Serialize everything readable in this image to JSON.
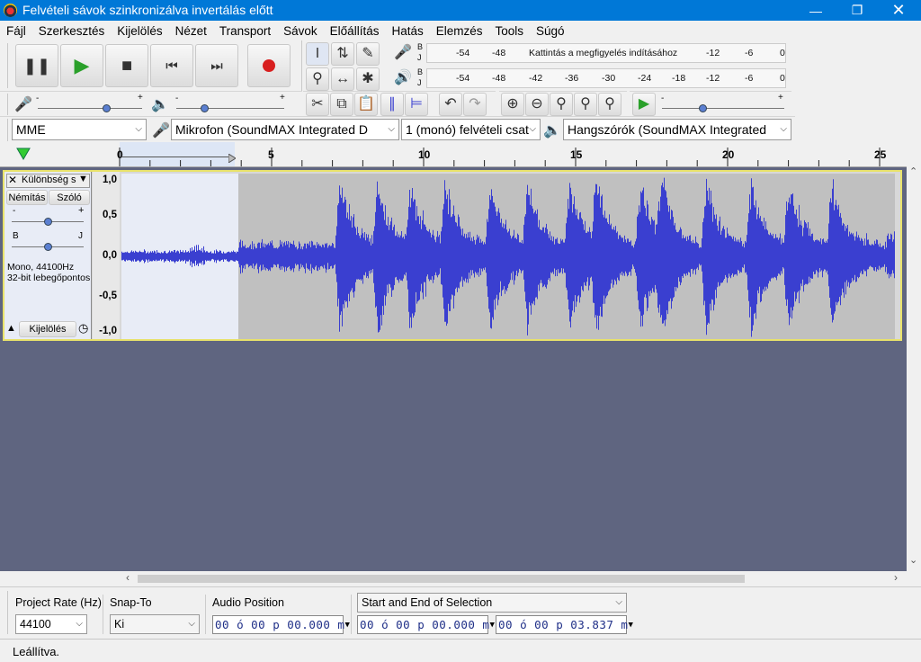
{
  "window": {
    "title": "Felvételi sávok szinkronizálva invertálás előtt"
  },
  "menu": [
    "Fájl",
    "Szerkesztés",
    "Kijelölés",
    "Nézet",
    "Transport",
    "Sávok",
    "Előállítás",
    "Hatás",
    "Elemzés",
    "Tools",
    "Súgó"
  ],
  "meter": {
    "rec_scale_left": [
      "-54",
      "-48"
    ],
    "rec_hint": "Kattintás a megfigyelés indításához",
    "rec_scale_right": [
      "-12",
      "-6",
      "0"
    ],
    "play_scale": [
      "-54",
      "-48",
      "-42",
      "-36",
      "-30",
      "-24",
      "-18",
      "-12",
      "-6",
      "0"
    ],
    "channel_left": "B",
    "channel_right": "J"
  },
  "devices": {
    "host": "MME",
    "mic": "Mikrofon (SoundMAX Integrated D",
    "channels": "1 (monó) felvételi csat",
    "speaker": "Hangszórók (SoundMAX Integrated"
  },
  "ruler": {
    "labels": [
      "0",
      "5",
      "10",
      "15",
      "20",
      "25"
    ]
  },
  "track": {
    "name": "Különbség s",
    "mute": "Némítás",
    "solo": "Szóló",
    "pan_left": "B",
    "pan_right": "J",
    "gain_minus": "-",
    "gain_plus": "+",
    "format_line1": "Mono, 44100Hz",
    "format_line2": "32-bit lebegőpontos",
    "select_label": "Kijelölés",
    "y_labels": [
      "1,0",
      "0,5",
      "0,0",
      "-0,5",
      "-1,0"
    ]
  },
  "selection_bar": {
    "project_rate_label": "Project Rate (Hz)",
    "project_rate_value": "44100",
    "snap_label": "Snap-To",
    "snap_value": "Ki",
    "audio_position_label": "Audio Position",
    "audio_position_value": "00 ó 00 p 00.000 m",
    "selection_mode": "Start and End of Selection",
    "selection_start": "00 ó 00 p 00.000 m",
    "selection_end": "00 ó 00 p 03.837 m"
  },
  "status": {
    "text": "Leállítva."
  },
  "colors": {
    "titlebar": "#0078d7",
    "waveform": "#3a3fd0",
    "selection": "#e8ecf6",
    "track_border": "#e8e26b"
  }
}
